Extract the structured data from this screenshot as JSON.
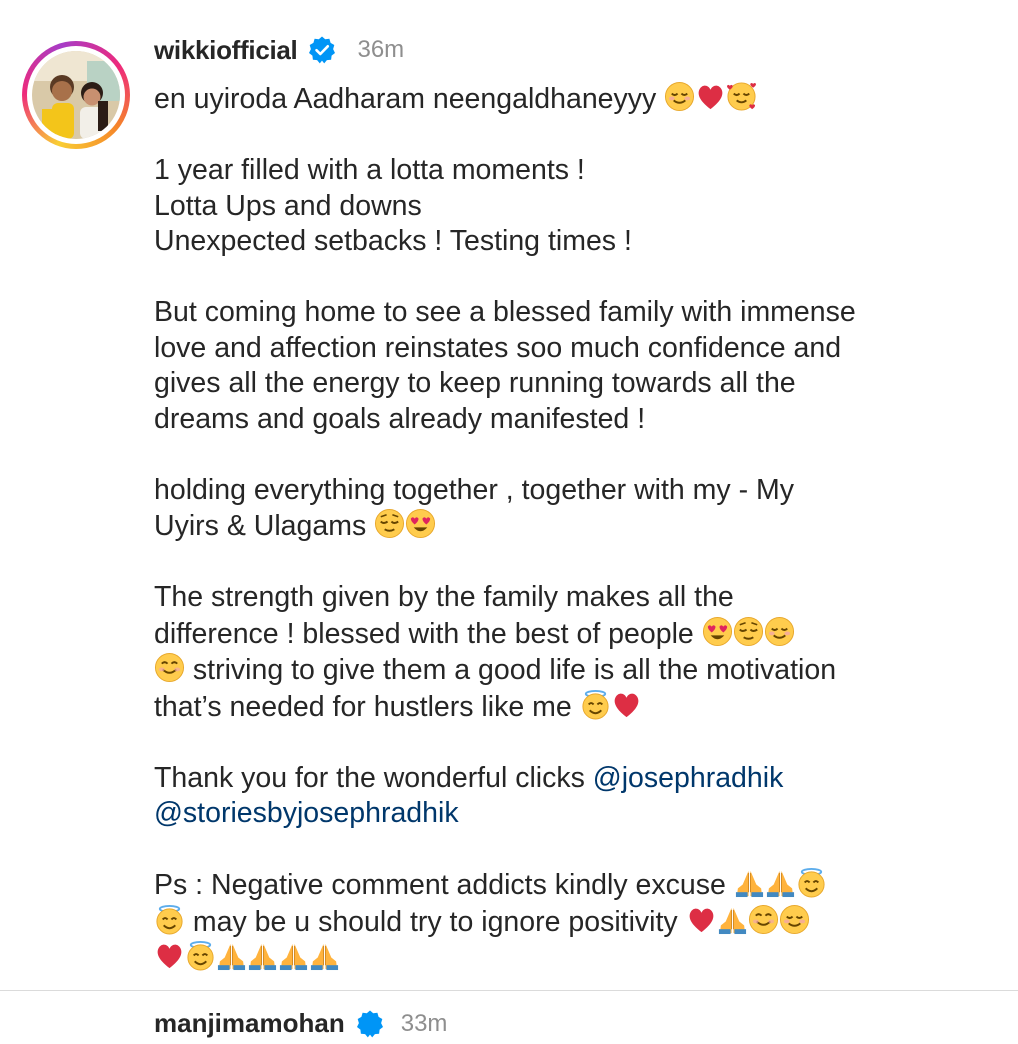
{
  "post": {
    "username": "wikkiofficial",
    "verified": true,
    "time": "36m",
    "caption": {
      "line1": "en uyiroda Aadharam neengaldhaneyyy",
      "line1_emoji": [
        "smiling-face",
        "red-heart",
        "smiling-face-with-hearts"
      ],
      "para2": [
        "1 year filled with a lotta moments !",
        "Lotta Ups and downs",
        "Unexpected setbacks ! Testing times !"
      ],
      "para3": [
        "But coming home to see a blessed family with immense",
        "love and affection reinstates soo much confidence and",
        "gives all the energy to keep running towards all the",
        "dreams and goals already manifested !"
      ],
      "para4_line1": "holding everything together , together with my - My",
      "para4_line2": "Uyirs & Ulagams",
      "para5_line1": "The strength given by the family makes all the",
      "para5_line2": "difference ! blessed with the best of people",
      "para5_line3": "striving to give them a good life is all the motivation",
      "para5_line4": "that’s needed for hustlers like me",
      "para6_text": "Thank you for the wonderful clicks",
      "mention1": "@josephradhik",
      "mention2": "@storiesbyjosephradhik",
      "para7_line1": "Ps : Negative comment addicts kindly excuse",
      "para7_line2": "may be u should try to ignore positivity"
    }
  },
  "next_comment": {
    "username": "manjimamohan",
    "time": "33m"
  },
  "colors": {
    "text": "#262626",
    "muted": "#8e8e8e",
    "mention": "#00376b",
    "verified": "#0095f6"
  }
}
